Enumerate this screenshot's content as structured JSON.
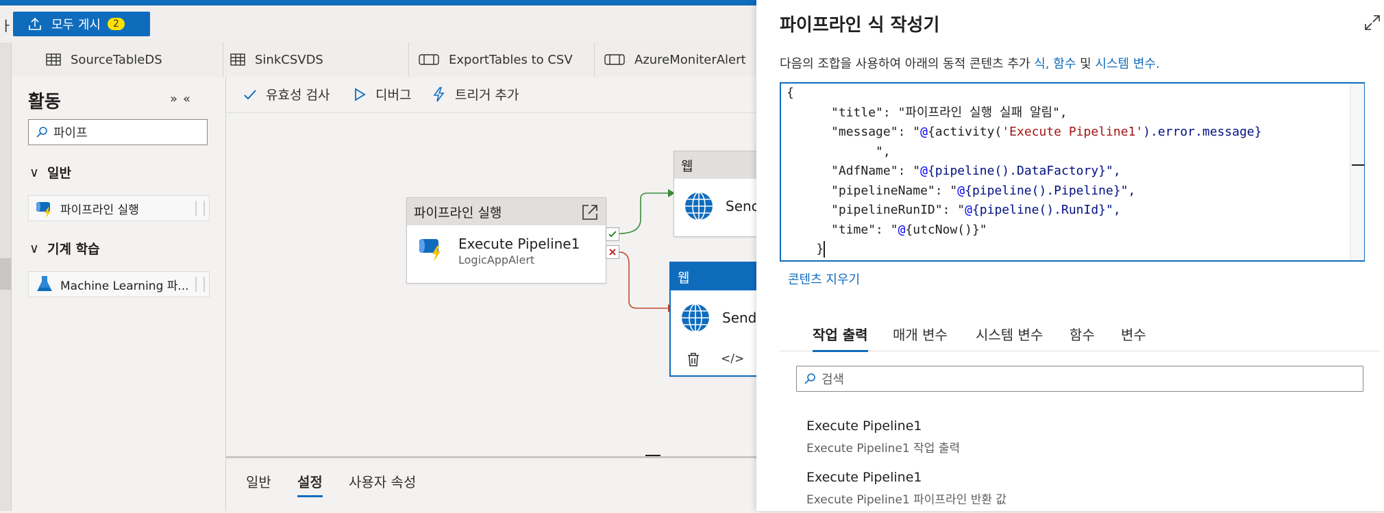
{
  "publish": {
    "label": "모두 게시",
    "count": "2",
    "cut_text": "ㅏ"
  },
  "tabs": [
    {
      "label": "SourceTableDS",
      "icon": "table-icon"
    },
    {
      "label": "SinkCSVDS",
      "icon": "table-icon"
    },
    {
      "label": "ExportTables to CSV",
      "icon": "pipeline-icon"
    },
    {
      "label": "AzureMoniterAlert",
      "icon": "pipeline-icon"
    }
  ],
  "activities": {
    "title": "활동",
    "search_value": "파이프",
    "categories": [
      {
        "label": "일반",
        "items": [
          {
            "label": "파이프라인 실행"
          }
        ]
      },
      {
        "label": "기계 학습",
        "items": [
          {
            "label": "Machine Learning 파..."
          }
        ]
      }
    ]
  },
  "canvas_toolbar": {
    "validate": "유효성 검사",
    "debug": "디버그",
    "trigger": "트리거 추가"
  },
  "nodes": {
    "execute": {
      "header": "파이프라인 실행",
      "name": "Execute Pipeline1",
      "sub": "LogicAppAlert"
    },
    "web1": {
      "header": "웹",
      "name": "Senc"
    },
    "web2": {
      "header": "웹",
      "name": "Send"
    }
  },
  "bottom_tabs": [
    "일반",
    "설정",
    "사용자 속성"
  ],
  "drawer": {
    "title": "파이프라인 식 작성기",
    "desc_prefix": "다음의 조합을 사용하여 아래의 동적 콘텐츠 추가 ",
    "link_expr": "식,",
    "link_func": "함수",
    "desc_and": " 및 ",
    "link_sysvar": "시스템 변수.",
    "clear": "콘텐츠 지우기",
    "tabs": [
      "작업 출력",
      "매개 변수",
      "시스템 변수",
      "함수",
      "변수"
    ],
    "search_placeholder": "검색",
    "results": [
      {
        "title": "Execute Pipeline1",
        "sub": "Execute Pipeline1 작업 출력"
      },
      {
        "title": "Execute Pipeline1",
        "sub": "Execute Pipeline1 파이프라인 반환 값"
      }
    ],
    "code": {
      "open": "{",
      "title_key": "\"title\": ",
      "title_val": "\"파이프라인 실행 실패 알림\",",
      "message_key": "\"message\": ",
      "message_open": "\"",
      "at": "@",
      "message_fn": "{activity(",
      "message_arg": "'Execute Pipeline1'",
      "message_rest": ").error.message}",
      "message_close": "\",",
      "adf_key": "\"AdfName\": ",
      "adf_rest": "{pipeline().DataFactory}\",",
      "pname_key": "\"pipelineName\": ",
      "pname_rest": "{pipeline().Pipeline}\",",
      "prun_key": "\"pipelineRunID\": ",
      "prun_rest": "{pipeline().RunId}\",",
      "time_key": "\"time\": ",
      "time_rest": "{utcNow()}\"",
      "close": "}"
    }
  }
}
